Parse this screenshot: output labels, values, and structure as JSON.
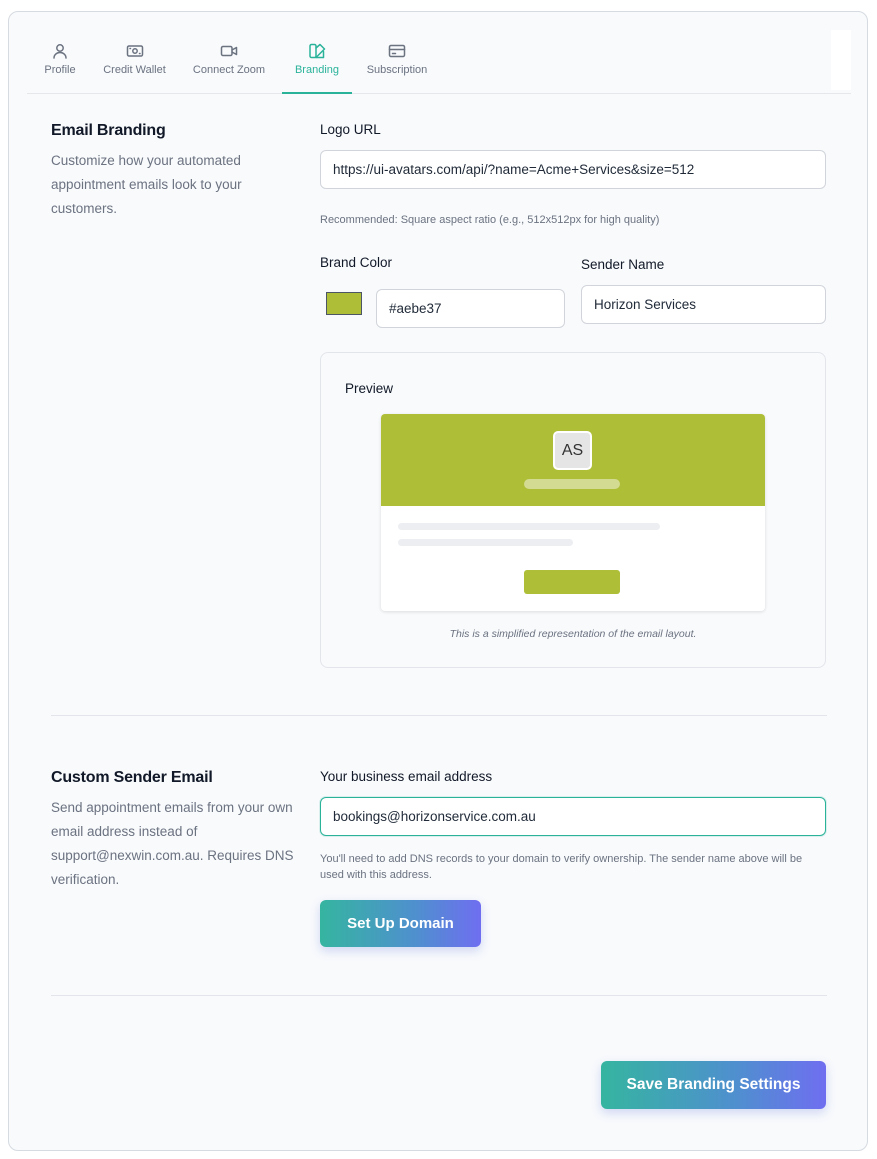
{
  "tabs": [
    {
      "label": "Profile",
      "icon": "user-icon"
    },
    {
      "label": "Credit Wallet",
      "icon": "wallet-icon"
    },
    {
      "label": "Connect Zoom",
      "icon": "video-icon"
    },
    {
      "label": "Branding",
      "icon": "palette-icon"
    },
    {
      "label": "Subscription",
      "icon": "card-icon"
    }
  ],
  "active_tab": "Branding",
  "email_branding": {
    "title": "Email Branding",
    "description": "Customize how your automated appointment emails look to your customers.",
    "logo_url_label": "Logo URL",
    "logo_url_value": "https://ui-avatars.com/api/?name=Acme+Services&size=512",
    "logo_hint": "Recommended: Square aspect ratio (e.g., 512x512px for high quality)",
    "brand_color_label": "Brand Color",
    "brand_color_value": "#aebe37",
    "sender_name_label": "Sender Name",
    "sender_name_value": "Horizon Services",
    "preview": {
      "title": "Preview",
      "avatar_initials": "AS",
      "caption": "This is a simplified representation of the email layout."
    }
  },
  "custom_sender": {
    "title": "Custom Sender Email",
    "description": "Send appointment emails from your own email address instead of support@nexwin.com.au. Requires DNS verification.",
    "email_label": "Your business email address",
    "email_value": "bookings@horizonservice.com.au",
    "hint": "You'll need to add DNS records to your domain to verify ownership. The sender name above will be used with this address.",
    "setup_button": "Set Up Domain"
  },
  "save_button": "Save Branding Settings",
  "colors": {
    "brand": "#aebe37",
    "accent": "#2bb39a"
  }
}
